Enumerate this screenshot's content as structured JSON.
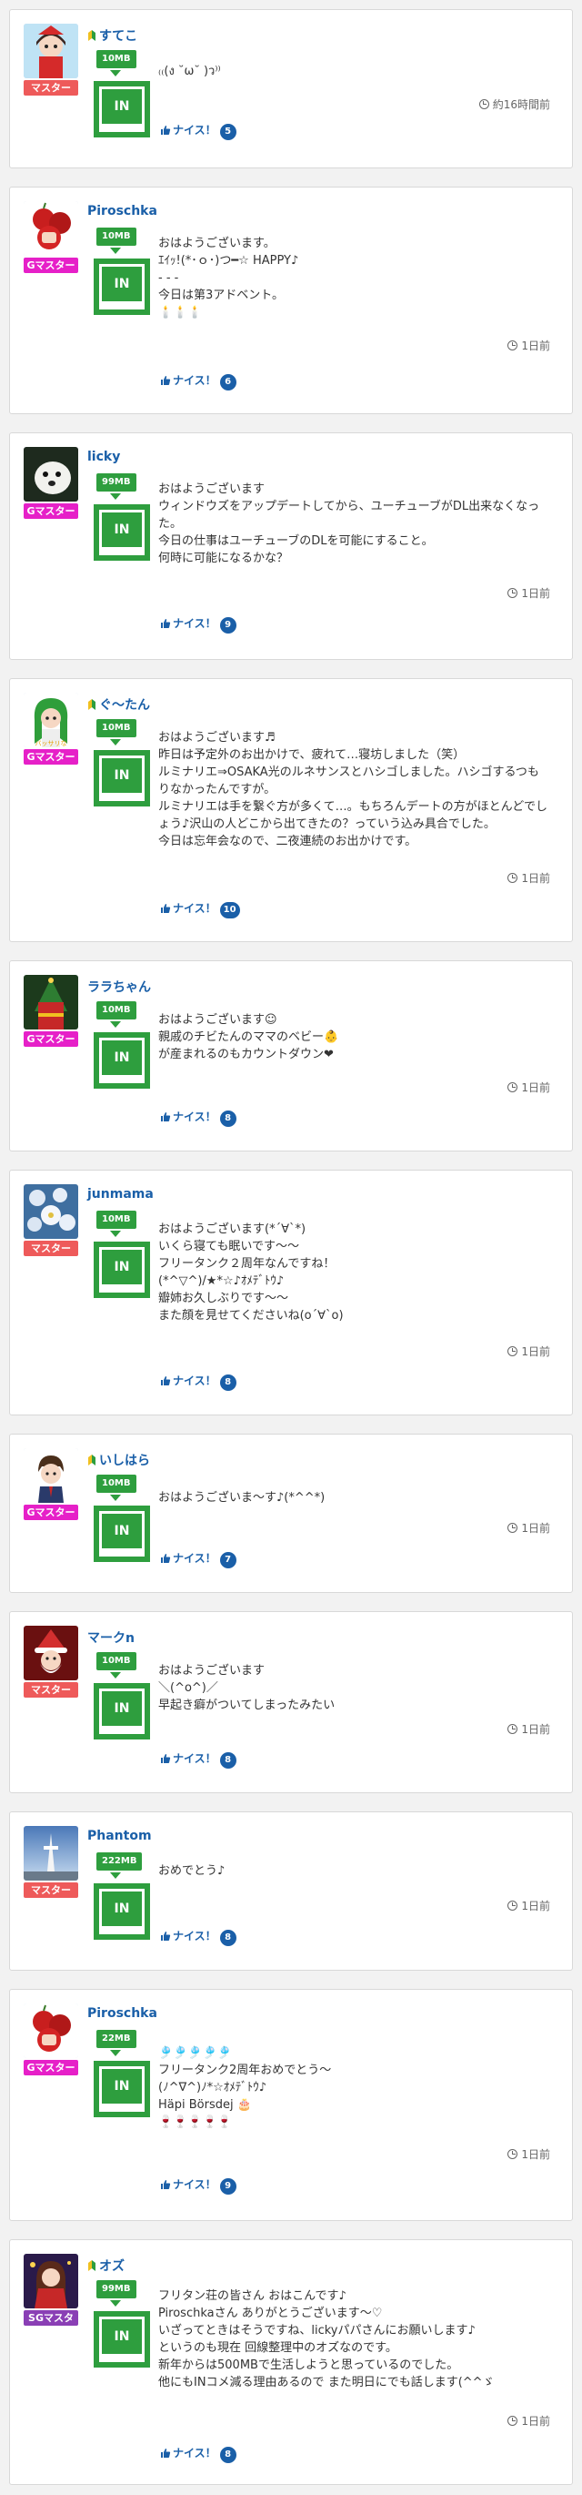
{
  "common": {
    "in_label": "IN",
    "nice_label": "ナイス！"
  },
  "colors": {
    "green": "#2e9e3e",
    "link_blue": "#1a5fa8",
    "rank_magenta": "#e620c8",
    "rank_red": "#ee5a5a",
    "rank_purple": "#8a3fb5"
  },
  "posts": [
    {
      "name": "すてこ",
      "beginner": true,
      "rank": "マスター",
      "rank_color": "#ee5a5a",
      "mb": "10MB",
      "message": "₍₍(ง ˘ω˘ )ว⁾⁾",
      "time": "約16時間前",
      "nice_count": "5",
      "avatar_icon": "girl-avatar-icon"
    },
    {
      "name": "Piroschka",
      "beginner": false,
      "rank": "Gマスター",
      "rank_color": "#e620c8",
      "mb": "10MB",
      "message": "おはようございます。\nｴｲｯ!(*･ｏ･)つ━☆ HAPPY♪\n- - -\n今日は第3アドベント。\n🕯️🕯️🕯️",
      "time": "1日前",
      "nice_count": "6",
      "avatar_icon": "apple-avatar-icon"
    },
    {
      "name": "licky",
      "beginner": false,
      "rank": "Gマスター",
      "rank_color": "#e620c8",
      "mb": "99MB",
      "message": "おはようございます\nウィンドウズをアップデートしてから、ユーチューブがDL出来なくなった。\n今日の仕事はユーチューブのDLを可能にすること。\n何時に可能になるかな？",
      "time": "1日前",
      "nice_count": "9",
      "avatar_icon": "white-dog-avatar-icon"
    },
    {
      "name": "ぐ～たん",
      "beginner": true,
      "rank": "Gマスター",
      "rank_color": "#e620c8",
      "mb": "10MB",
      "message": "おはようございます♬\n昨日は予定外のお出かけで、疲れて…寝坊しました（笑）\nルミナリエ⇒OSAKA光のルネサンスとハシゴしました。ハシゴするつもりなかったんですが。\nルミナリエは手を繋ぐ方が多くて…。もちろんデートの方がほとんどでしょう♪沢山の人どこから出てきたの？っていう込み具合でした。\n今日は忘年会なので、二夜連続のお出かけです。",
      "time": "1日前",
      "nice_count": "10",
      "avatar_icon": "green-hair-girl-avatar-icon"
    },
    {
      "name": "ララちゃん",
      "beginner": false,
      "rank": "Gマスター",
      "rank_color": "#e620c8",
      "mb": "10MB",
      "message": "おはようございます☺\n親戚のチビたんのママのベビー👶\nが産まれるのもカウントダウン❤",
      "time": "1日前",
      "nice_count": "8",
      "avatar_icon": "christmas-avatar-icon"
    },
    {
      "name": "junmama",
      "beginner": false,
      "rank": "マスター",
      "rank_color": "#ee5a5a",
      "mb": "10MB",
      "message": "おはようございます(*´∀`*)\nいくら寝ても眠いです〜〜\nフリータンク２周年なんですね！\n(*^▽^)/★*☆♪ｵﾒﾃﾞﾄｳ♪\n瓣姉お久しぶりです〜〜\nまた顔を見せてくださいね(o´∀`o)",
      "time": "1日前",
      "nice_count": "8",
      "avatar_icon": "flowers-avatar-icon"
    },
    {
      "name": "いしはら",
      "beginner": true,
      "rank": "Gマスター",
      "rank_color": "#e620c8",
      "mb": "10MB",
      "message": "おはようございま～す♪(*^^*)",
      "time": "1日前",
      "nice_count": "7",
      "avatar_icon": "boy-avatar-icon"
    },
    {
      "name": "マークn",
      "beginner": false,
      "rank": "マスター",
      "rank_color": "#ee5a5a",
      "mb": "10MB",
      "message": "おはようございます\n＼(^o^)／\n早起き癖がついてしまったみたい",
      "time": "1日前",
      "nice_count": "8",
      "avatar_icon": "santa-avatar-icon"
    },
    {
      "name": "Phantom",
      "beginner": false,
      "rank": "マスター",
      "rank_color": "#ee5a5a",
      "mb": "222MB",
      "message": "おめでとう♪",
      "time": "1日前",
      "nice_count": "8",
      "avatar_icon": "tower-avatar-icon"
    },
    {
      "name": "Piroschka",
      "beginner": false,
      "rank": "Gマスター",
      "rank_color": "#e620c8",
      "mb": "22MB",
      "message": "🎐🎐🎐🎐🎐\nフリータンク2周年おめでとう〜\n(ﾉ^∇^)ﾉ*☆ｵﾒﾃﾞﾄｳ♪\nHäpi Börsdej 🎂\n🍷🍷🍷🍷🍷",
      "time": "1日前",
      "nice_count": "9",
      "avatar_icon": "apple-avatar-icon"
    },
    {
      "name": "オズ",
      "beginner": true,
      "rank": "SGマスタ",
      "rank_color": "#8a3fb5",
      "mb": "99MB",
      "message": "フリタン荘の皆さん おはこんです♪\nPiroschkaさん ありがとうございます〜♡\nいざってときはそうですね、lickyパパさんにお願いします♪\nというのも現在 回線整理中のオズなのです。\n新年からは500MBで生活しようと思っているのでした。\n他にもINコメ減る理由あるので また明日にでも話します(^^ゞ",
      "time": "1日前",
      "nice_count": "8",
      "avatar_icon": "red-costume-avatar-icon"
    }
  ]
}
